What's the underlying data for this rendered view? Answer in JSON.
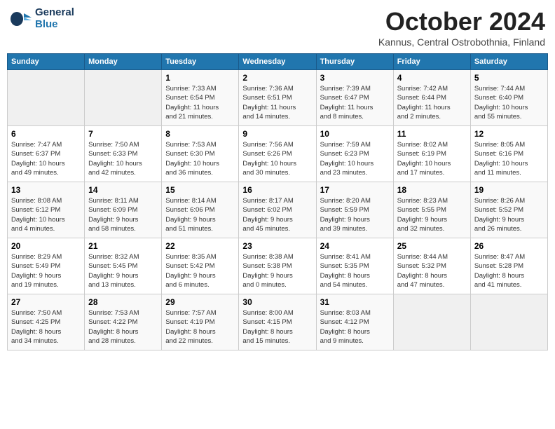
{
  "header": {
    "logo_line1": "General",
    "logo_line2": "Blue",
    "month": "October 2024",
    "location": "Kannus, Central Ostrobothnia, Finland"
  },
  "weekdays": [
    "Sunday",
    "Monday",
    "Tuesday",
    "Wednesday",
    "Thursday",
    "Friday",
    "Saturday"
  ],
  "weeks": [
    [
      {
        "day": "",
        "info": ""
      },
      {
        "day": "",
        "info": ""
      },
      {
        "day": "1",
        "info": "Sunrise: 7:33 AM\nSunset: 6:54 PM\nDaylight: 11 hours\nand 21 minutes."
      },
      {
        "day": "2",
        "info": "Sunrise: 7:36 AM\nSunset: 6:51 PM\nDaylight: 11 hours\nand 14 minutes."
      },
      {
        "day": "3",
        "info": "Sunrise: 7:39 AM\nSunset: 6:47 PM\nDaylight: 11 hours\nand 8 minutes."
      },
      {
        "day": "4",
        "info": "Sunrise: 7:42 AM\nSunset: 6:44 PM\nDaylight: 11 hours\nand 2 minutes."
      },
      {
        "day": "5",
        "info": "Sunrise: 7:44 AM\nSunset: 6:40 PM\nDaylight: 10 hours\nand 55 minutes."
      }
    ],
    [
      {
        "day": "6",
        "info": "Sunrise: 7:47 AM\nSunset: 6:37 PM\nDaylight: 10 hours\nand 49 minutes."
      },
      {
        "day": "7",
        "info": "Sunrise: 7:50 AM\nSunset: 6:33 PM\nDaylight: 10 hours\nand 42 minutes."
      },
      {
        "day": "8",
        "info": "Sunrise: 7:53 AM\nSunset: 6:30 PM\nDaylight: 10 hours\nand 36 minutes."
      },
      {
        "day": "9",
        "info": "Sunrise: 7:56 AM\nSunset: 6:26 PM\nDaylight: 10 hours\nand 30 minutes."
      },
      {
        "day": "10",
        "info": "Sunrise: 7:59 AM\nSunset: 6:23 PM\nDaylight: 10 hours\nand 23 minutes."
      },
      {
        "day": "11",
        "info": "Sunrise: 8:02 AM\nSunset: 6:19 PM\nDaylight: 10 hours\nand 17 minutes."
      },
      {
        "day": "12",
        "info": "Sunrise: 8:05 AM\nSunset: 6:16 PM\nDaylight: 10 hours\nand 11 minutes."
      }
    ],
    [
      {
        "day": "13",
        "info": "Sunrise: 8:08 AM\nSunset: 6:12 PM\nDaylight: 10 hours\nand 4 minutes."
      },
      {
        "day": "14",
        "info": "Sunrise: 8:11 AM\nSunset: 6:09 PM\nDaylight: 9 hours\nand 58 minutes."
      },
      {
        "day": "15",
        "info": "Sunrise: 8:14 AM\nSunset: 6:06 PM\nDaylight: 9 hours\nand 51 minutes."
      },
      {
        "day": "16",
        "info": "Sunrise: 8:17 AM\nSunset: 6:02 PM\nDaylight: 9 hours\nand 45 minutes."
      },
      {
        "day": "17",
        "info": "Sunrise: 8:20 AM\nSunset: 5:59 PM\nDaylight: 9 hours\nand 39 minutes."
      },
      {
        "day": "18",
        "info": "Sunrise: 8:23 AM\nSunset: 5:55 PM\nDaylight: 9 hours\nand 32 minutes."
      },
      {
        "day": "19",
        "info": "Sunrise: 8:26 AM\nSunset: 5:52 PM\nDaylight: 9 hours\nand 26 minutes."
      }
    ],
    [
      {
        "day": "20",
        "info": "Sunrise: 8:29 AM\nSunset: 5:49 PM\nDaylight: 9 hours\nand 19 minutes."
      },
      {
        "day": "21",
        "info": "Sunrise: 8:32 AM\nSunset: 5:45 PM\nDaylight: 9 hours\nand 13 minutes."
      },
      {
        "day": "22",
        "info": "Sunrise: 8:35 AM\nSunset: 5:42 PM\nDaylight: 9 hours\nand 6 minutes."
      },
      {
        "day": "23",
        "info": "Sunrise: 8:38 AM\nSunset: 5:38 PM\nDaylight: 9 hours\nand 0 minutes."
      },
      {
        "day": "24",
        "info": "Sunrise: 8:41 AM\nSunset: 5:35 PM\nDaylight: 8 hours\nand 54 minutes."
      },
      {
        "day": "25",
        "info": "Sunrise: 8:44 AM\nSunset: 5:32 PM\nDaylight: 8 hours\nand 47 minutes."
      },
      {
        "day": "26",
        "info": "Sunrise: 8:47 AM\nSunset: 5:28 PM\nDaylight: 8 hours\nand 41 minutes."
      }
    ],
    [
      {
        "day": "27",
        "info": "Sunrise: 7:50 AM\nSunset: 4:25 PM\nDaylight: 8 hours\nand 34 minutes."
      },
      {
        "day": "28",
        "info": "Sunrise: 7:53 AM\nSunset: 4:22 PM\nDaylight: 8 hours\nand 28 minutes."
      },
      {
        "day": "29",
        "info": "Sunrise: 7:57 AM\nSunset: 4:19 PM\nDaylight: 8 hours\nand 22 minutes."
      },
      {
        "day": "30",
        "info": "Sunrise: 8:00 AM\nSunset: 4:15 PM\nDaylight: 8 hours\nand 15 minutes."
      },
      {
        "day": "31",
        "info": "Sunrise: 8:03 AM\nSunset: 4:12 PM\nDaylight: 8 hours\nand 9 minutes."
      },
      {
        "day": "",
        "info": ""
      },
      {
        "day": "",
        "info": ""
      }
    ]
  ]
}
